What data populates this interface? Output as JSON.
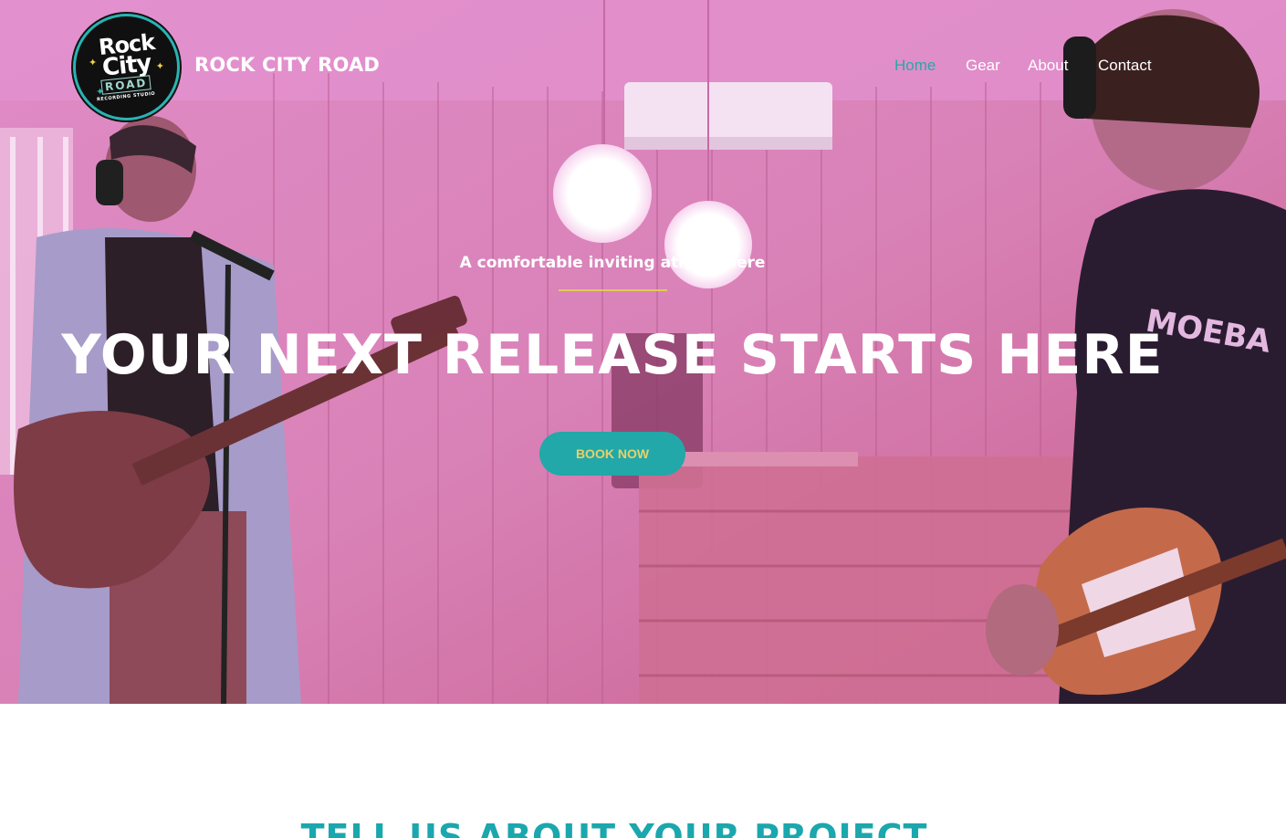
{
  "brand": {
    "logo_text_line1": "Rock",
    "logo_text_line2": "City",
    "logo_text_line3": "ROAD",
    "logo_subtext": "RECORDING STUDIO",
    "name": "ROCK CITY ROAD"
  },
  "nav": {
    "items": [
      {
        "label": "Home",
        "active": true
      },
      {
        "label": "Gear",
        "active": false
      },
      {
        "label": "About",
        "active": false
      },
      {
        "label": "Contact",
        "active": false
      }
    ]
  },
  "hero": {
    "tagline": "A comfortable inviting atmosphere",
    "headline": "YOUR NEXT RELEASE STARTS HERE",
    "cta_label": "BOOK NOW"
  },
  "next_section": {
    "title": "TELL US ABOUT YOUR PROJECT"
  },
  "colors": {
    "accent_teal": "#22a8a8",
    "accent_gold": "#e3c85a",
    "hero_overlay": "#d06aa8"
  }
}
